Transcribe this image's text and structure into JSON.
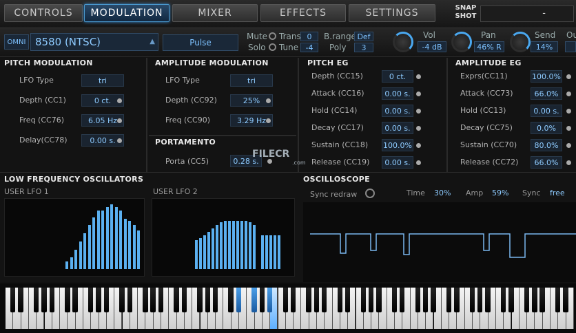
{
  "tabs": [
    {
      "label": "CONTROLS",
      "active": false
    },
    {
      "label": "MODULATION",
      "active": true
    },
    {
      "label": "MIXER",
      "active": false
    },
    {
      "label": "EFFECTS",
      "active": false
    },
    {
      "label": "SETTINGS",
      "active": false
    }
  ],
  "snapshot": {
    "label_line1": "SNAP",
    "label_line2": "SHOT",
    "value": "-"
  },
  "header": {
    "omni": "OMNI",
    "patch": "8580 (NTSC)",
    "preset": "Pulse",
    "mute": "Mute",
    "solo": "Solo",
    "trans_label": "Trans",
    "trans_value": "0",
    "tune_label": "Tune",
    "tune_value": "-4",
    "brange_label": "B.range",
    "brange_value": "Def",
    "poly_label": "Poly",
    "poly_value": "3",
    "vol_label": "Vol",
    "vol_value": "-4 dB",
    "pan_label": "Pan",
    "pan_value": "46% R",
    "send_label": "Send",
    "send_value": "14%",
    "out_label": "Ou"
  },
  "pitch_mod": {
    "title": "PITCH MODULATION",
    "rows": [
      {
        "label": "LFO Type",
        "value": "tri"
      },
      {
        "label": "Depth (CC1)",
        "value": "0 ct."
      },
      {
        "label": "Freq (CC76)",
        "value": "6.05 Hz"
      },
      {
        "label": "Delay(CC78)",
        "value": "0.00 s."
      }
    ]
  },
  "amp_mod": {
    "title": "AMPLITUDE MODULATION",
    "rows": [
      {
        "label": "LFO Type",
        "value": "tri"
      },
      {
        "label": "Depth (CC92)",
        "value": "25%"
      },
      {
        "label": "Freq (CC90)",
        "value": "3.29 Hz"
      }
    ]
  },
  "portamento": {
    "title": "PORTAMENTO",
    "label": "Porta (CC5)",
    "value": "0.28 s."
  },
  "pitch_eg": {
    "title": "PITCH EG",
    "rows": [
      {
        "label": "Depth (CC15)",
        "value": "0 ct."
      },
      {
        "label": "Attack (CC16)",
        "value": "0.00 s."
      },
      {
        "label": "Hold (CC14)",
        "value": "0.00 s."
      },
      {
        "label": "Decay (CC17)",
        "value": "0.00 s."
      },
      {
        "label": "Sustain (CC18)",
        "value": "100.0%"
      },
      {
        "label": "Release (CC19)",
        "value": "0.00 s."
      }
    ]
  },
  "amp_eg": {
    "title": "AMPLITUDE EG",
    "rows": [
      {
        "label": "Exprs(CC11)",
        "value": "100.0%"
      },
      {
        "label": "Attack (CC73)",
        "value": "66.0%"
      },
      {
        "label": "Hold (CC13)",
        "value": "0.00 s."
      },
      {
        "label": "Decay (CC75)",
        "value": "0.0%"
      },
      {
        "label": "Sustain (CC70)",
        "value": "80.0%"
      },
      {
        "label": "Release (CC72)",
        "value": "66.0%"
      }
    ]
  },
  "lfo": {
    "title": "LOW FREQUENCY OSCILLATORS",
    "lfo1": "USER LFO 1",
    "lfo2": "USER LFO 2",
    "lfo1_values": [
      0,
      0,
      0,
      0,
      0,
      0,
      0,
      0,
      0,
      0,
      0,
      0,
      0,
      0,
      0,
      0,
      0,
      0,
      0,
      0,
      0,
      0,
      0,
      0,
      0,
      0,
      0,
      0,
      0,
      0,
      0,
      0,
      0,
      0,
      0,
      0,
      0,
      0,
      0,
      0,
      0,
      0,
      0,
      0,
      0,
      0,
      0,
      0,
      0,
      0,
      0,
      0,
      0,
      0,
      0,
      0,
      0,
      0,
      0,
      0,
      0,
      0,
      0,
      0,
      0,
      0,
      0,
      0,
      0,
      0,
      0,
      0,
      0,
      0,
      0,
      0,
      0,
      0,
      0,
      0,
      0,
      0,
      0,
      0,
      0,
      0,
      0,
      0,
      0,
      0,
      0,
      0,
      0,
      0,
      0,
      0,
      0,
      0,
      0,
      0
    ],
    "lfo1_bars": [
      0.12,
      0.18,
      0.3,
      0.43,
      0.55,
      0.68,
      0.8,
      0.9,
      0.9,
      0.96,
      1.0,
      0.96,
      0.9,
      0.78,
      0.74,
      0.68,
      0.6
    ],
    "lfo2_bars": [
      0.45,
      0.48,
      0.52,
      0.57,
      0.63,
      0.68,
      0.72,
      0.74,
      0.74,
      0.74,
      0.74,
      0.74,
      0.74,
      0.72,
      0.68,
      0,
      0.52,
      0.52,
      0.52,
      0.52,
      0.52
    ]
  },
  "scope": {
    "title": "OSCILLOSCOPE",
    "sync_redraw": "Sync redraw",
    "time_label": "Time",
    "time_value": "30%",
    "amp_label": "Amp",
    "amp_value": "59%",
    "sync_label": "Sync",
    "sync_value": "free"
  },
  "watermark": "FILECR",
  "watermark_sub": ".com",
  "colors": {
    "accent": "#4aa8f0",
    "value_text": "#8ecbff"
  }
}
